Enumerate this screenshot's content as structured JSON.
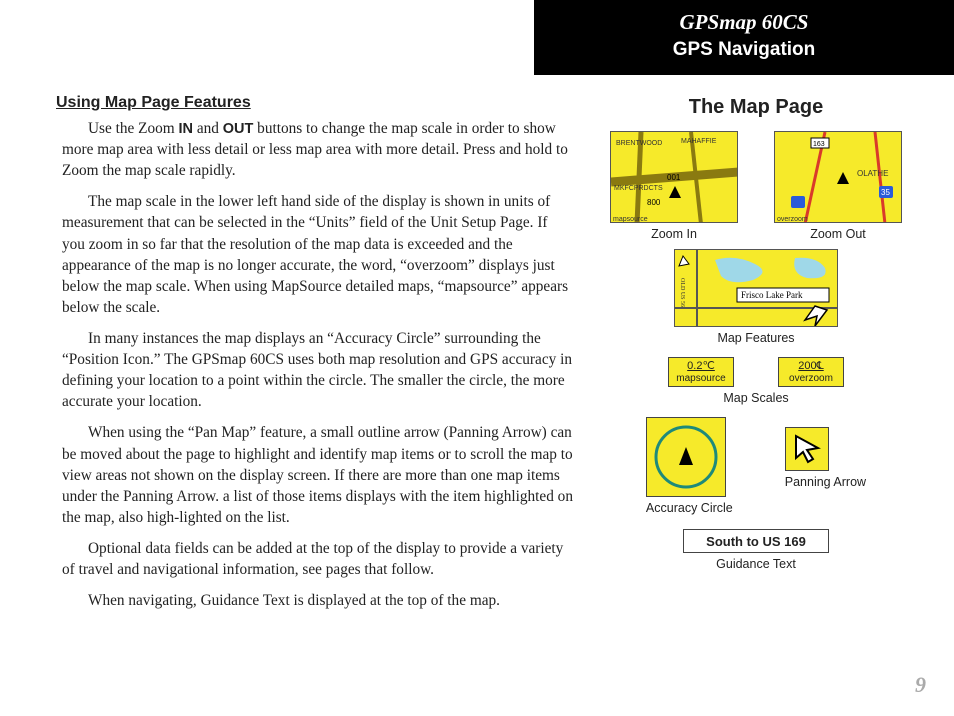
{
  "header": {
    "title": "GPSmap 60CS",
    "subtitle": "GPS Navigation"
  },
  "left": {
    "section_title": " Using Map Page Features",
    "p1a": "Use the Zoom ",
    "p1_in": "IN",
    "p1b": " and ",
    "p1_out": "OUT",
    "p1c": " buttons to change the map scale in order to show more map area with less detail or less map area with more detail. Press and hold to Zoom the map scale rapidly.",
    "p2": "The map scale in the lower left hand side of the display is shown in units of measurement that can be selected in the “Units” field of the Unit Setup Page. If you zoom in so far that the resolution of the map data is exceeded and the appearance of the map is no longer accurate, the word, “overzoom” displays just below the map scale. When using MapSource detailed maps, “mapsource” appears below the scale.",
    "p3": "In many instances the map displays an “Accuracy Circle” surrounding the “Position Icon.” The GPSmap 60CS uses both map resolution and GPS accuracy in defining your location to a point within the circle. The smaller the circle, the more accurate your location.",
    "p4": "When using the “Pan Map” feature, a small outline arrow (Panning Arrow) can be moved about the page to highlight and identify map items or to scroll the map to view areas not shown on the display screen. If there are more than one map items under the Panning Arrow. a list of those items displays with the item highlighted on the map, also high-lighted on the list.",
    "p5": "Optional data fields can be added at the top of the display to provide a variety of travel and navigational information, see pages that follow.",
    "p6": "When navigating, Guidance Text is displayed at the top of the map."
  },
  "right": {
    "title": "The Map Page",
    "zoom_in": {
      "caption": "Zoom In",
      "labels": [
        "BRENTWOOD",
        "MAHAFFIE",
        "MKFCPRDCTS",
        "mapsource",
        "001",
        "800"
      ]
    },
    "zoom_out": {
      "caption": "Zoom Out",
      "labels": [
        "OLATHE",
        "overzoom",
        "35",
        "163"
      ]
    },
    "features": {
      "caption": "Map Features",
      "labels": [
        "Frisco Lake Park",
        "OLD US 56"
      ]
    },
    "scales": {
      "caption": "Map Scales",
      "left": {
        "top": "0.2℃",
        "bottom": "mapsource"
      },
      "right": {
        "top": "200℄",
        "bottom": "overzoom"
      }
    },
    "accuracy": {
      "caption": "Accuracy Circle"
    },
    "panning": {
      "caption": "Panning Arrow"
    },
    "guidance": {
      "text": "South to US 169",
      "caption": "Guidance Text"
    }
  },
  "page_number": "9"
}
